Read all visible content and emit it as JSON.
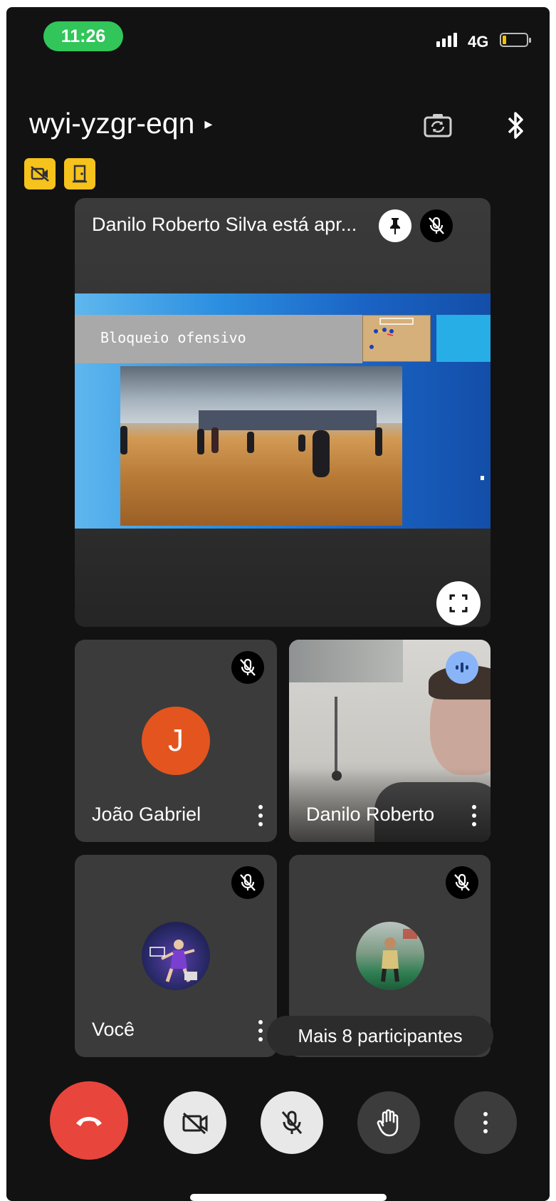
{
  "status_bar": {
    "time": "11:26",
    "network": "4G"
  },
  "header": {
    "meeting_code": "wyi-yzgr-eqn",
    "caret": "▸"
  },
  "presentation": {
    "title": "Danilo Roberto Silva está apr...",
    "slide_title": "Bloqueio ofensivo"
  },
  "participants": [
    {
      "name": "João Gabriel",
      "initial": "J",
      "avatar_color": "#e4541f",
      "muted": true
    },
    {
      "name": "Danilo Roberto",
      "speaking": true
    },
    {
      "name": "Você",
      "muted": true
    },
    {
      "name": "",
      "muted": true
    }
  ],
  "more_participants": "Mais 8 participantes",
  "colors": {
    "end_call": "#e8453c",
    "status_pill": "#31c55a",
    "badge": "#f6c21c",
    "speaking": "#8ab4f8"
  },
  "icons": [
    "camera-flip-icon",
    "bluetooth-icon",
    "no-video-badge-icon",
    "door-badge-icon",
    "pin-icon",
    "mic-off-icon",
    "fullscreen-icon",
    "more-vert-icon",
    "speaking-icon",
    "end-call-icon",
    "camera-off-icon",
    "raise-hand-icon"
  ]
}
